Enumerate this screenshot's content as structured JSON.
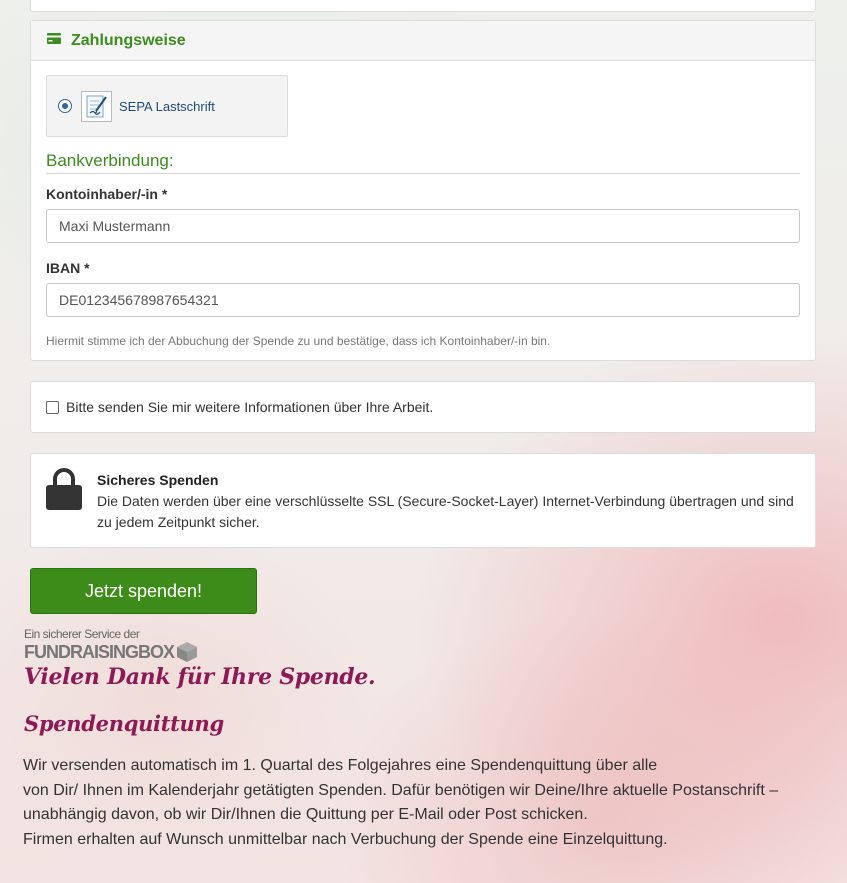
{
  "payment": {
    "title": "Zahlungsweise",
    "method": {
      "label": "SEPA Lastschrift",
      "selected": true
    },
    "bank_title": "Bankverbindung:",
    "account_holder": {
      "label": "Kontoinhaber/-in *",
      "value": "Maxi Mustermann"
    },
    "iban": {
      "label": "IBAN *",
      "value": "DE012345678987654321"
    },
    "consent_note": "Hiermit stimme ich der Abbuchung der Spende zu und bestätige, dass ich Kontoinhaber/-in bin."
  },
  "info_opt_in": {
    "label": "Bitte senden Sie mir weitere Informationen über Ihre Arbeit.",
    "checked": false
  },
  "secure": {
    "title": "Sicheres Spenden",
    "text": "Die Daten werden über eine verschlüsselte SSL (Secure-Socket-Layer) Internet-Verbindung übertragen und sind zu jedem Zeitpunkt sicher."
  },
  "submit_label": "Jetzt spenden!",
  "branding": {
    "sub": "Ein sicherer Service der",
    "name_part1": "FUNDRAISING",
    "name_part2": "BOX"
  },
  "thanks": "Vielen Dank für Ihre Spende.",
  "receipt": {
    "title": "Spendenquittung",
    "lines": [
      "Wir versenden automatisch im 1. Quartal des Folgejahres eine Spendenquittung über alle",
      "von Dir/ Ihnen im Kalenderjahr getätigten Spenden. Dafür benötigen wir Deine/Ihre aktuelle Postanschrift –",
      "unabhängig davon, ob wir Dir/Ihnen die Quittung per E-Mail oder Post schicken.",
      "Firmen erhalten auf Wunsch unmittelbar nach Verbuchung der Spende eine Einzelquittung."
    ]
  },
  "colors": {
    "accent_green": "#3c8c1e",
    "button_green": "#3d8b19",
    "heading_purple": "#8b1a55",
    "radio_blue": "#2a69a8"
  },
  "icons": [
    "credit-card-icon",
    "sepa-form-icon",
    "lock-icon",
    "box-logo-icon"
  ]
}
